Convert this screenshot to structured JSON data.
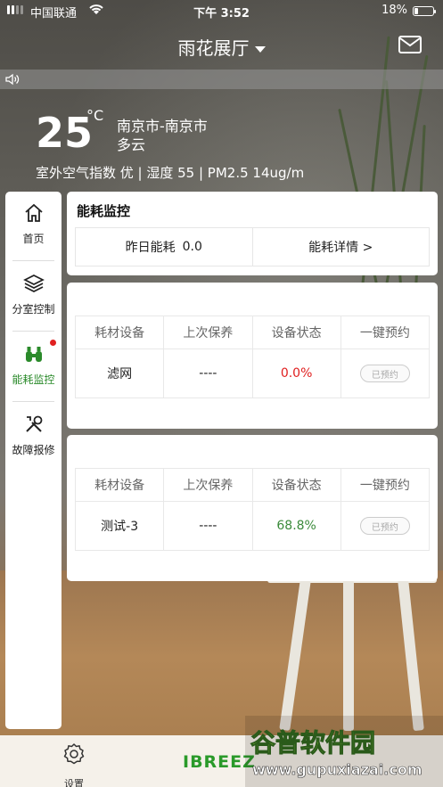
{
  "status_bar": {
    "carrier": "中国联通",
    "time": "下午 3:52",
    "battery": "18%"
  },
  "header": {
    "title": "雨花展厅"
  },
  "weather": {
    "temperature": "25",
    "unit": "°C",
    "city": "南京市-南京市",
    "condition": "多云",
    "air_quality": "室外空气指数 优 | 湿度 55 | PM2.5 14ug/m"
  },
  "sidebar": {
    "items": [
      {
        "label": "首页",
        "icon": "home-icon"
      },
      {
        "label": "分室控制",
        "icon": "layers-icon"
      },
      {
        "label": "能耗监控",
        "icon": "energy-monitor-icon"
      },
      {
        "label": "故障报修",
        "icon": "tools-icon"
      }
    ]
  },
  "energy_card": {
    "title": "能耗监控",
    "yesterday_label": "昨日能耗",
    "yesterday_value": "0.0",
    "details_link": "能耗详情 >"
  },
  "consumables_tables": [
    {
      "headers": [
        "耗材设备",
        "上次保养",
        "设备状态",
        "一键预约"
      ],
      "row": {
        "device": "滤网",
        "last_maintenance": "----",
        "status": "0.0%",
        "action": "已预约"
      }
    },
    {
      "headers": [
        "耗材设备",
        "上次保养",
        "设备状态",
        "一键预约"
      ],
      "row": {
        "device": "测试-3",
        "last_maintenance": "----",
        "status": "68.8%",
        "action": "已预约"
      }
    }
  ],
  "tabbar": {
    "settings_label": "设置",
    "brand": "IBREEZ"
  },
  "watermark": {
    "line1": "谷普软件园",
    "line2": "www.gupuxiazai.com"
  },
  "colors": {
    "accent_green": "#2a9a2a",
    "status_red": "#e02020",
    "status_green": "#3a8a3a",
    "badge_red": "#e02020"
  }
}
